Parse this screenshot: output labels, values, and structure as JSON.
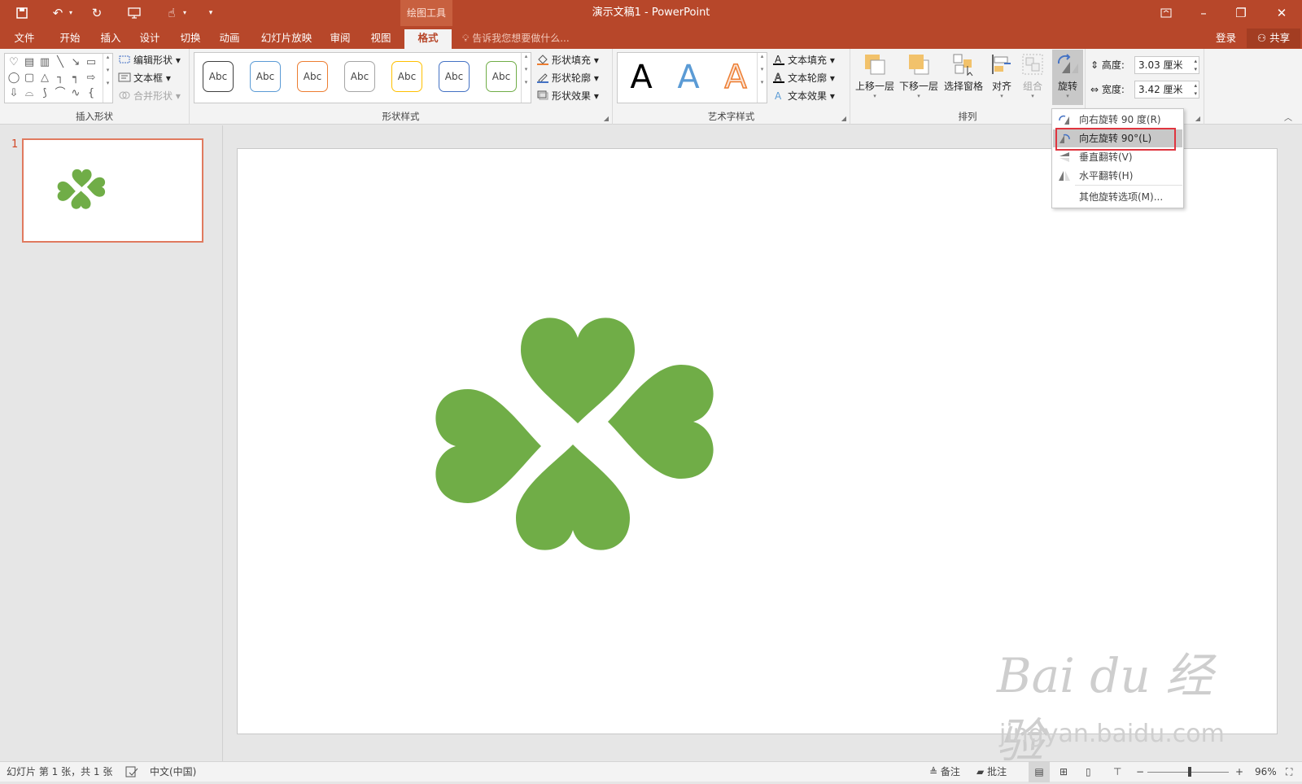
{
  "window": {
    "context_tab": "绘图工具",
    "title": "演示文稿1 - PowerPoint"
  },
  "tabs": [
    "文件",
    "开始",
    "插入",
    "设计",
    "切换",
    "动画",
    "幻灯片放映",
    "审阅",
    "视图",
    "格式"
  ],
  "active_tab": "格式",
  "tell_me": "告诉我您想要做什么...",
  "account": {
    "login": "登录",
    "share": "共享"
  },
  "ribbon": {
    "insert_shapes": {
      "label": "插入形状",
      "edit_shape": "编辑形状",
      "text_box": "文本框",
      "merge_shapes": "合并形状"
    },
    "shape_styles": {
      "label": "形状样式",
      "swatch_text": "Abc",
      "swatch_colors": [
        "#404040",
        "#5b9bd5",
        "#ed7d31",
        "#a5a5a5",
        "#ffc000",
        "#4472c4",
        "#70ad47"
      ],
      "fill": "形状填充",
      "outline": "形状轮廓",
      "effects": "形状效果"
    },
    "wordart": {
      "label": "艺术字样式",
      "letter": "A",
      "text_fill": "文本填充",
      "text_outline": "文本轮廓",
      "text_effects": "文本效果"
    },
    "arrange": {
      "label": "排列",
      "bring_forward": "上移一层",
      "send_backward": "下移一层",
      "selection_pane": "选择窗格",
      "align": "对齐",
      "group": "组合",
      "rotate": "旋转"
    },
    "size": {
      "height_label": "高度:",
      "height_value": "3.03 厘米",
      "width_label": "宽度:",
      "width_value": "3.42 厘米"
    }
  },
  "rotate_menu": {
    "items": [
      "向右旋转 90 度(R)",
      "向左旋转 90°(L)",
      "垂直翻转(V)",
      "水平翻转(H)",
      "其他旋转选项(M)..."
    ],
    "highlighted_index": 1
  },
  "slides": {
    "current_number": "1"
  },
  "clover_color": "#70ad47",
  "watermark": {
    "logo": "Bai du 经验",
    "url": "jingyan.baidu.com"
  },
  "status": {
    "slide_info": "幻灯片 第 1 张，共 1 张",
    "language": "中文(中国)",
    "notes": "备注",
    "comments": "批注",
    "zoom": "96%"
  }
}
